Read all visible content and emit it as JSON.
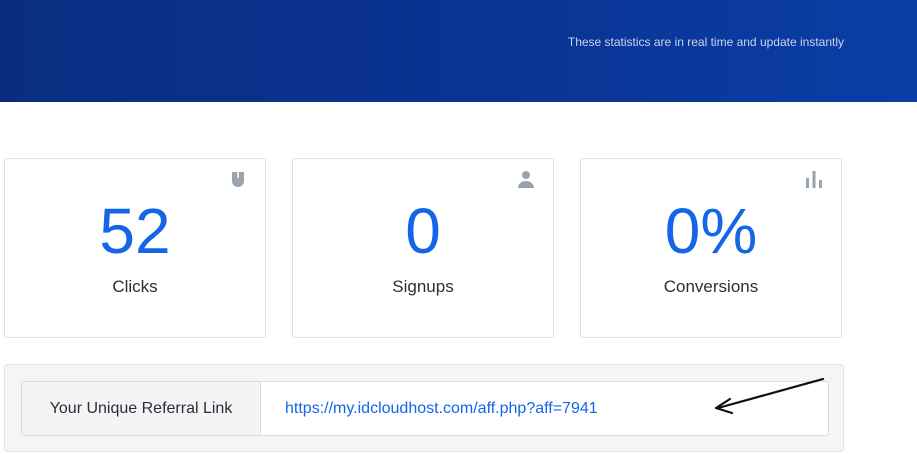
{
  "header": {
    "subtitle": "These statistics are in real time and update instantly"
  },
  "stats": [
    {
      "value": "52",
      "label": "Clicks",
      "icon": "mouse-icon"
    },
    {
      "value": "0",
      "label": "Signups",
      "icon": "user-icon"
    },
    {
      "value": "0%",
      "label": "Conversions",
      "icon": "bar-chart-icon"
    }
  ],
  "referral": {
    "label": "Your Unique Referral Link",
    "url": "https://my.idcloudhost.com/aff.php?aff=7941"
  },
  "colors": {
    "header_bg": "#0a3494",
    "accent": "#1565e8",
    "icon_gray": "#9aa3ad"
  }
}
